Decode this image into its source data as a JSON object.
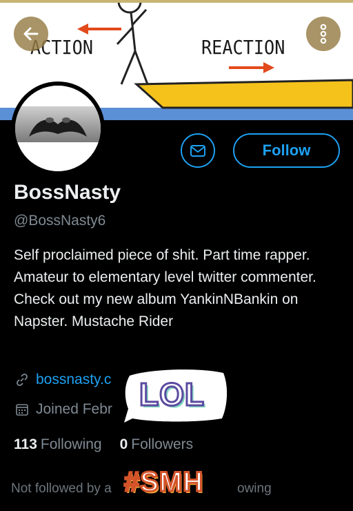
{
  "banner": {
    "left_text": "ACTION",
    "right_text": "REACTION"
  },
  "nav": {
    "back_icon": "back-arrow-icon",
    "more_icon": "more-vertical-icon"
  },
  "profile": {
    "name": "BossNasty",
    "handle": "@BossNasty6",
    "bio": "Self proclaimed piece of shit. Part time rapper. Amateur to elementary level twitter commenter. Check out my new album YankinNBankin on Napster. Mustache Rider",
    "link_text": "bossnasty.c",
    "joined_text": "Joined Febr"
  },
  "actions": {
    "message_icon": "mail-icon",
    "follow_label": "Follow"
  },
  "stats": {
    "following_count": "113",
    "following_label": "Following",
    "followers_count": "0",
    "followers_label": "Followers"
  },
  "footer": {
    "not_followed_prefix": "Not followed by a",
    "not_followed_suffix": "owing"
  },
  "stickers": {
    "lol": "LOL",
    "smh": "#SMH"
  },
  "colors": {
    "accent": "#1da1f2",
    "background": "#000000",
    "banner_boat": "#f5c21b",
    "banner_water": "#5b8fd6"
  }
}
